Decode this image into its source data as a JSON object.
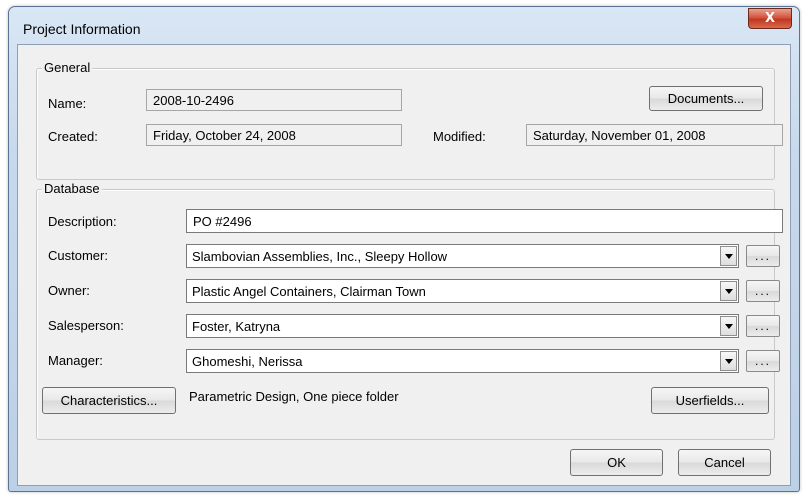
{
  "window": {
    "title": "Project Information",
    "close_label": "X"
  },
  "general": {
    "legend": "General",
    "name_label": "Name:",
    "name_value": "2008-10-2496",
    "created_label": "Created:",
    "created_value": "Friday, October 24, 2008",
    "modified_label": "Modified:",
    "modified_value": "Saturday, November 01, 2008",
    "documents_button": "Documents..."
  },
  "database": {
    "legend": "Database",
    "description_label": "Description:",
    "description_value": "PO #2496",
    "customer_label": "Customer:",
    "customer_value": "Slambovian Assemblies, Inc., Sleepy Hollow",
    "owner_label": "Owner:",
    "owner_value": "Plastic Angel Containers, Clairman Town",
    "salesperson_label": "Salesperson:",
    "salesperson_value": "Foster, Katryna",
    "manager_label": "Manager:",
    "manager_value": "Ghomeshi, Nerissa",
    "browse_label": "...",
    "characteristics_button": "Characteristics...",
    "characteristics_text": "Parametric Design, One piece folder",
    "userfields_button": "Userfields..."
  },
  "footer": {
    "ok": "OK",
    "cancel": "Cancel"
  }
}
